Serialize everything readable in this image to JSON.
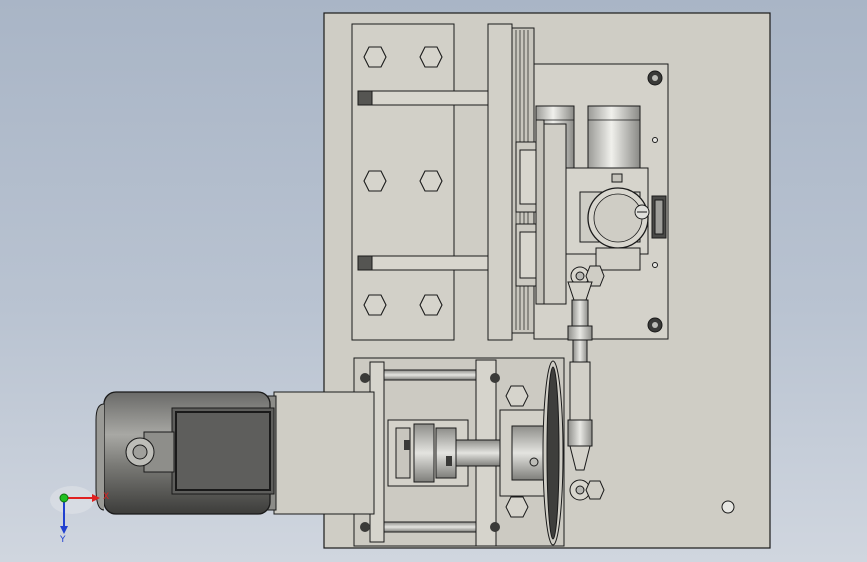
{
  "viewport": {
    "background_top": "#a9b5c6",
    "background_bottom": "#d0d6df"
  },
  "model": {
    "part_fill": "#cfcdc5",
    "outline": "#1a1a1a",
    "motor_dark": "#4a4a48",
    "motor_mid": "#8c8c88"
  },
  "triad": {
    "x_label": "X",
    "y_label": "Y",
    "x_color": "#e02020",
    "y_color": "#2040d0",
    "z_color": "#20c020"
  }
}
